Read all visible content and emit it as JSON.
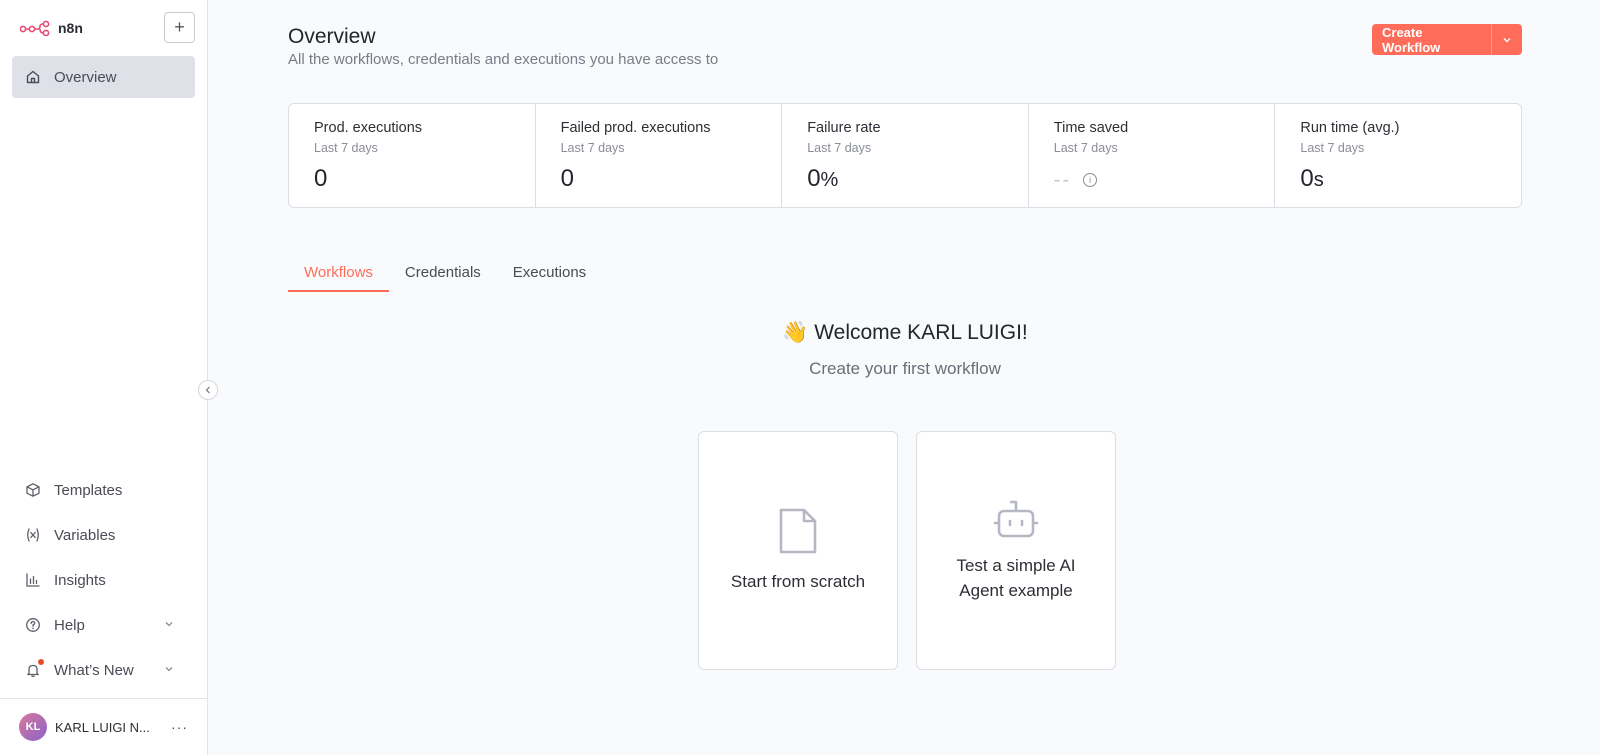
{
  "app": {
    "name": "n8n"
  },
  "sidebar": {
    "add_label": "+",
    "overview_label": "Overview",
    "bottom_items": [
      {
        "label": "Templates"
      },
      {
        "label": "Variables"
      },
      {
        "label": "Insights"
      },
      {
        "label": "Help"
      },
      {
        "label": "What’s New"
      }
    ],
    "user": {
      "initials": "KL",
      "name": "KARL LUIGI N..."
    }
  },
  "header": {
    "title": "Overview",
    "subtitle": "All the workflows, credentials and executions you have access to",
    "create_label": "Create Workflow"
  },
  "stats": [
    {
      "title": "Prod. executions",
      "period": "Last 7 days",
      "value": "0",
      "unit": ""
    },
    {
      "title": "Failed prod. executions",
      "period": "Last 7 days",
      "value": "0",
      "unit": ""
    },
    {
      "title": "Failure rate",
      "period": "Last 7 days",
      "value": "0",
      "unit": "%"
    },
    {
      "title": "Time saved",
      "period": "Last 7 days",
      "value": "--",
      "unit": ""
    },
    {
      "title": "Run time (avg.)",
      "period": "Last 7 days",
      "value": "0",
      "unit": "s"
    }
  ],
  "tabs": [
    {
      "label": "Workflows",
      "active": true
    },
    {
      "label": "Credentials",
      "active": false
    },
    {
      "label": "Executions",
      "active": false
    }
  ],
  "welcome": {
    "emoji": "👋",
    "title": "Welcome KARL LUIGI!",
    "subtitle": "Create your first workflow"
  },
  "cards": [
    {
      "label": "Start from scratch"
    },
    {
      "label": "Test a simple AI Agent example"
    }
  ],
  "colors": {
    "accent": "#ff6d5a",
    "nav_active_bg": "#dfe1e9"
  }
}
